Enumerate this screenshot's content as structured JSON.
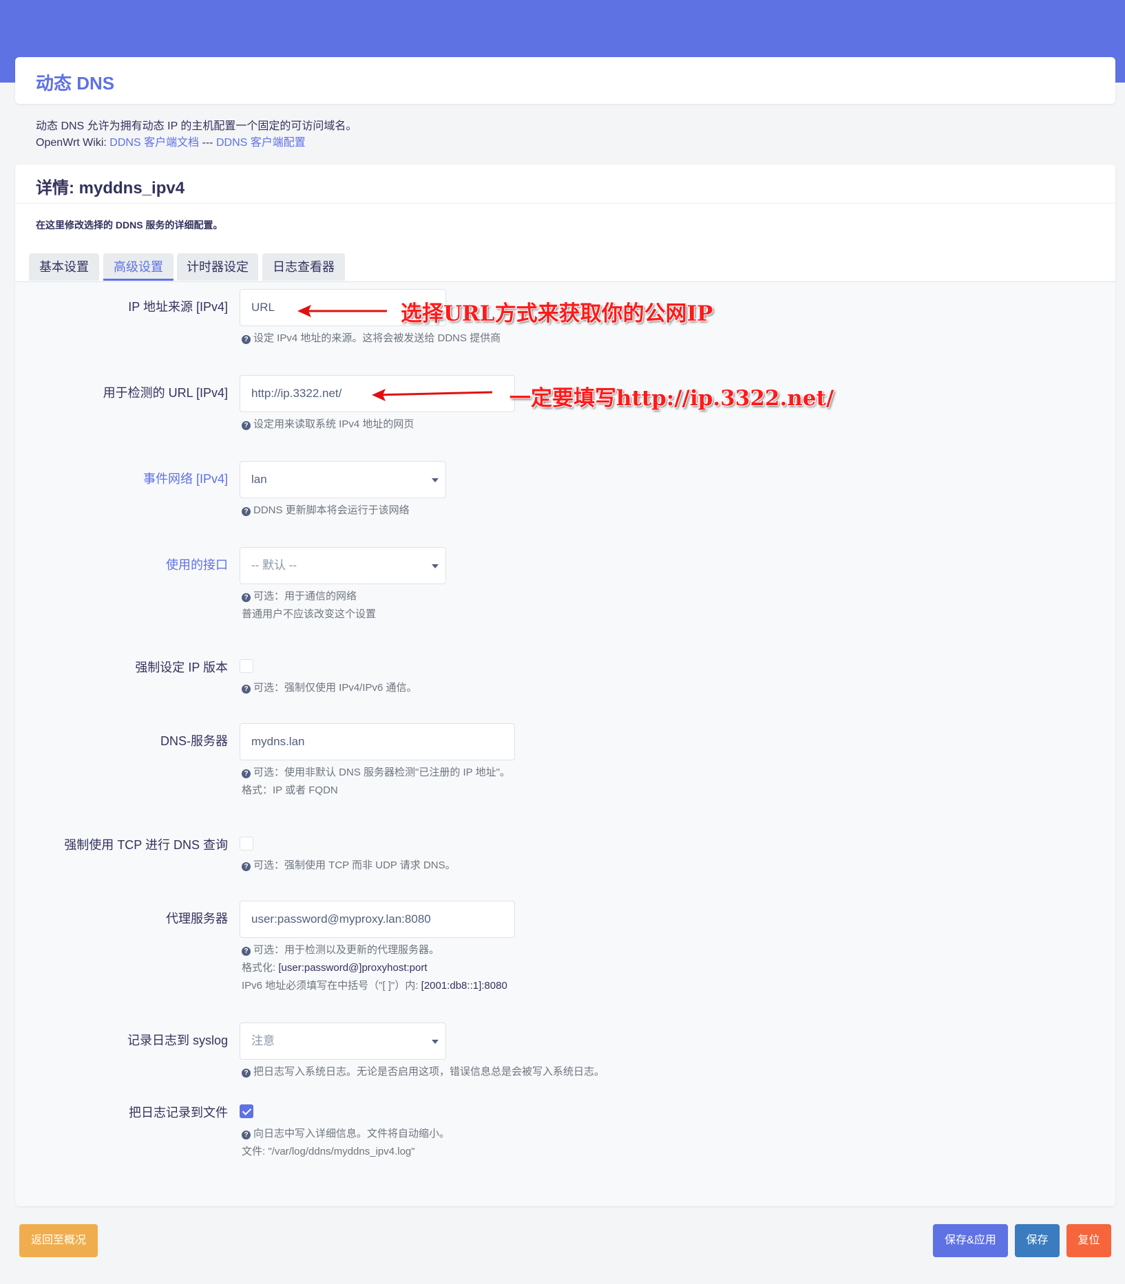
{
  "header": {
    "title": "动态 DNS"
  },
  "intro": {
    "line1": "动态 DNS 允许为拥有动态 IP 的主机配置一个固定的可访问域名。",
    "wiki_prefix": "OpenWrt Wiki: ",
    "wiki_link1": "DDNS 客户端文档",
    "wiki_sep": " --- ",
    "wiki_link2": "DDNS 客户端配置"
  },
  "details": {
    "title": "详情: myddns_ipv4",
    "description": "在这里修改选择的 DDNS 服务的详细配置。"
  },
  "tabs": [
    {
      "label": "基本设置",
      "active": false
    },
    {
      "label": "高级设置",
      "active": true
    },
    {
      "label": "计时器设定",
      "active": false
    },
    {
      "label": "日志查看器",
      "active": false
    }
  ],
  "fields": {
    "ip_source": {
      "label": "IP 地址来源 [IPv4]",
      "value": "URL",
      "help": "设定 IPv4 地址的来源。这将会被发送给 DDNS 提供商"
    },
    "check_url": {
      "label": "用于检测的 URL [IPv4]",
      "value": "http://ip.3322.net/",
      "help": "设定用来读取系统 IPv4 地址的网页"
    },
    "event_network": {
      "label": "事件网络 [IPv4]",
      "value": "lan",
      "help": "DDNS 更新脚本将会运行于该网络"
    },
    "interface": {
      "label": "使用的接口",
      "value": "-- 默认 --",
      "help1": "可选：用于通信的网络",
      "help2": "普通用户不应该改变这个设置"
    },
    "force_ip_version": {
      "label": "强制设定 IP 版本",
      "checked": false,
      "help": "可选：强制仅使用 IPv4/IPv6 通信。"
    },
    "dns_server": {
      "label": "DNS-服务器",
      "value": "mydns.lan",
      "help1": "可选：使用非默认 DNS 服务器检测\"已注册的 IP 地址\"。",
      "help2": "格式：IP 或者 FQDN"
    },
    "force_tcp": {
      "label": "强制使用 TCP 进行 DNS 查询",
      "checked": false,
      "help": "可选：强制使用 TCP 而非 UDP 请求 DNS。"
    },
    "proxy": {
      "label": "代理服务器",
      "value": "user:password@myproxy.lan:8080",
      "help1": "可选：用于检测以及更新的代理服务器。",
      "help2_prefix": "格式化: ",
      "help2_value": "[user:password@]proxyhost:port",
      "help3_prefix": "IPv6 地址必须填写在中括号（\"[ ]\"）内: ",
      "help3_value": "[2001:db8::1]:8080"
    },
    "syslog": {
      "label": "记录日志到 syslog",
      "value": "注意",
      "help": "把日志写入系统日志。无论是否启用这项，错误信息总是会被写入系统日志。"
    },
    "log_file": {
      "label": "把日志记录到文件",
      "checked": true,
      "help1": "向日志中写入详细信息。文件将自动缩小。",
      "help2": "文件: \"/var/log/ddns/myddns_ipv4.log\""
    }
  },
  "annotations": {
    "a1": "选择URL方式来获取你的公网IP",
    "a2": "一定要填写http://ip.3322.net/"
  },
  "buttons": {
    "back": "返回至概况",
    "save_apply": "保存&应用",
    "save": "保存",
    "reset": "复位"
  },
  "colors": {
    "primary": "#5e72e4",
    "back_button": "#f0ad4e",
    "save_button": "#3b7bbf",
    "reset_button": "#f6653c",
    "annotation": "#ff1a1a"
  }
}
